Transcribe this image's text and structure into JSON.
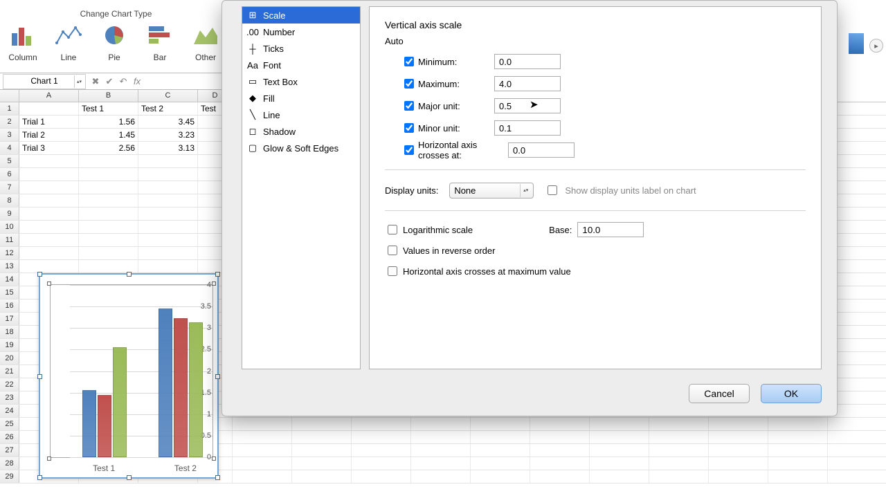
{
  "ribbon": {
    "group_label": "Change Chart Type",
    "buttons": [
      "Column",
      "Line",
      "Pie",
      "Bar",
      "Other"
    ]
  },
  "formula": {
    "name_box": "Chart 1"
  },
  "columns": [
    "A",
    "B",
    "C",
    "D"
  ],
  "table": {
    "headers": [
      "",
      "Test 1",
      "Test 2",
      "Test"
    ],
    "rows": [
      {
        "label": "Trial 1",
        "v": [
          1.56,
          3.45
        ]
      },
      {
        "label": "Trial 2",
        "v": [
          1.45,
          3.23
        ]
      },
      {
        "label": "Trial 3",
        "v": [
          2.56,
          3.13
        ]
      }
    ]
  },
  "chart_data": {
    "type": "bar",
    "categories": [
      "Test 1",
      "Test 2"
    ],
    "series": [
      {
        "name": "Trial 1",
        "values": [
          1.56,
          3.45
        ],
        "color": "#4f81bd"
      },
      {
        "name": "Trial 2",
        "values": [
          1.45,
          3.23
        ],
        "color": "#c0504d"
      },
      {
        "name": "Trial 3",
        "values": [
          2.56,
          3.13
        ],
        "color": "#9bbb59"
      }
    ],
    "ylim": [
      0,
      4
    ],
    "major_unit": 0.5,
    "y_ticks": [
      "4",
      "3.5",
      "3",
      "2.5",
      "2",
      "1.5",
      "1",
      "0.5",
      "0"
    ]
  },
  "dialog": {
    "sidebar": [
      "Scale",
      "Number",
      "Ticks",
      "Font",
      "Text Box",
      "Fill",
      "Line",
      "Shadow",
      "Glow & Soft Edges"
    ],
    "selected_sidebar": 0,
    "panel_title": "Vertical axis scale",
    "auto_label": "Auto",
    "fields": {
      "minimum": {
        "label": "Minimum:",
        "value": "0.0",
        "checked": true
      },
      "maximum": {
        "label": "Maximum:",
        "value": "4.0",
        "checked": true
      },
      "major": {
        "label": "Major unit:",
        "value": "0.5",
        "checked": true
      },
      "minor": {
        "label": "Minor unit:",
        "value": "0.1",
        "checked": true
      },
      "cross": {
        "label": "Horizontal axis crosses at:",
        "value": "0.0",
        "checked": true
      }
    },
    "display_units": {
      "label": "Display units:",
      "value": "None",
      "show_label": "Show display units label on chart",
      "show_checked": false
    },
    "log": {
      "label": "Logarithmic scale",
      "checked": false,
      "base_label": "Base:",
      "base_value": "10.0"
    },
    "reverse": {
      "label": "Values in reverse order",
      "checked": false
    },
    "cross_max": {
      "label": "Horizontal axis crosses at maximum value",
      "checked": false
    },
    "cancel": "Cancel",
    "ok": "OK"
  }
}
